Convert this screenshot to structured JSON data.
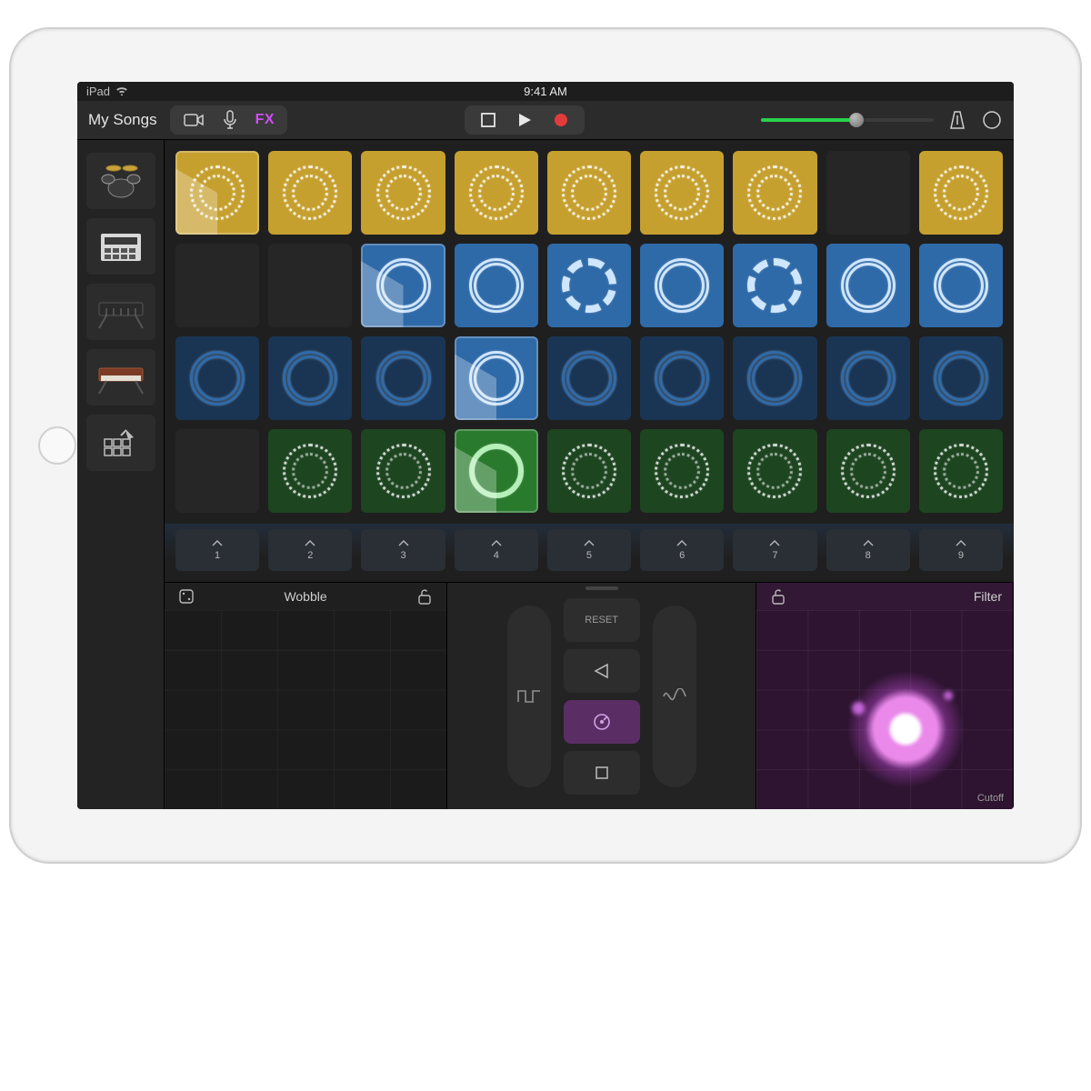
{
  "status": {
    "device": "iPad",
    "time": "9:41 AM"
  },
  "toolbar": {
    "back_label": "My Songs",
    "fx_label": "FX",
    "volume_percent": 55
  },
  "tracks": [
    {
      "id": "drums",
      "name": "drum-kit-icon"
    },
    {
      "id": "sampler",
      "name": "sampler-icon"
    },
    {
      "id": "keys1",
      "name": "keyboard-icon"
    },
    {
      "id": "keys2",
      "name": "synth-icon"
    },
    {
      "id": "grid",
      "name": "grid-edit-icon"
    }
  ],
  "grid": {
    "cols": 9,
    "rows": [
      {
        "color": "yellow",
        "cells": [
          {
            "filled": true,
            "variant": "dotted",
            "active": true
          },
          {
            "filled": true,
            "variant": "dotted"
          },
          {
            "filled": true,
            "variant": "dotted"
          },
          {
            "filled": true,
            "variant": "dotted"
          },
          {
            "filled": true,
            "variant": "dotted"
          },
          {
            "filled": true,
            "variant": "dotted"
          },
          {
            "filled": true,
            "variant": "dotted"
          },
          {
            "filled": false
          },
          {
            "filled": true,
            "variant": "dotted"
          }
        ]
      },
      {
        "color": "blue",
        "cells": [
          {
            "filled": false
          },
          {
            "filled": false
          },
          {
            "filled": true,
            "variant": "rough",
            "bright": true,
            "active": true
          },
          {
            "filled": true,
            "variant": "rough",
            "bright": true
          },
          {
            "filled": true,
            "variant": "segment",
            "bright": true
          },
          {
            "filled": true,
            "variant": "rough",
            "bright": true
          },
          {
            "filled": true,
            "variant": "segment",
            "bright": true
          },
          {
            "filled": true,
            "variant": "rough",
            "bright": true
          },
          {
            "filled": true,
            "variant": "rough",
            "bright": true
          }
        ]
      },
      {
        "color": "blue",
        "cells": [
          {
            "filled": true,
            "variant": "rough"
          },
          {
            "filled": true,
            "variant": "rough"
          },
          {
            "filled": true,
            "variant": "rough"
          },
          {
            "filled": true,
            "variant": "rough",
            "bright": true,
            "active": true
          },
          {
            "filled": true,
            "variant": "rough"
          },
          {
            "filled": true,
            "variant": "rough"
          },
          {
            "filled": true,
            "variant": "rough"
          },
          {
            "filled": true,
            "variant": "rough"
          },
          {
            "filled": true,
            "variant": "rough"
          }
        ]
      },
      {
        "color": "green",
        "cells": [
          {
            "filled": false
          },
          {
            "filled": true,
            "variant": "dotted"
          },
          {
            "filled": true,
            "variant": "dotted"
          },
          {
            "filled": true,
            "variant": "solid",
            "bright": true,
            "active": true
          },
          {
            "filled": true,
            "variant": "dotted"
          },
          {
            "filled": true,
            "variant": "dotted"
          },
          {
            "filled": true,
            "variant": "dotted"
          },
          {
            "filled": true,
            "variant": "dotted"
          },
          {
            "filled": true,
            "variant": "dotted"
          }
        ]
      }
    ]
  },
  "columns": [
    "1",
    "2",
    "3",
    "4",
    "5",
    "6",
    "7",
    "8",
    "9"
  ],
  "fx": {
    "left_pad_title": "Wobble",
    "right_pad_title": "Filter",
    "right_pad_x_label": "Cutoff",
    "reset_label": "RESET"
  },
  "colors": {
    "yellow": "#c6a02f",
    "blue": "#2f6aa8",
    "blue_dim": "#1a3554",
    "green": "#2a7a2e",
    "green_dim": "#1d4520",
    "accent_fx": "#cf4ef7",
    "record": "#e23b3b",
    "play_green": "#29d24a"
  }
}
